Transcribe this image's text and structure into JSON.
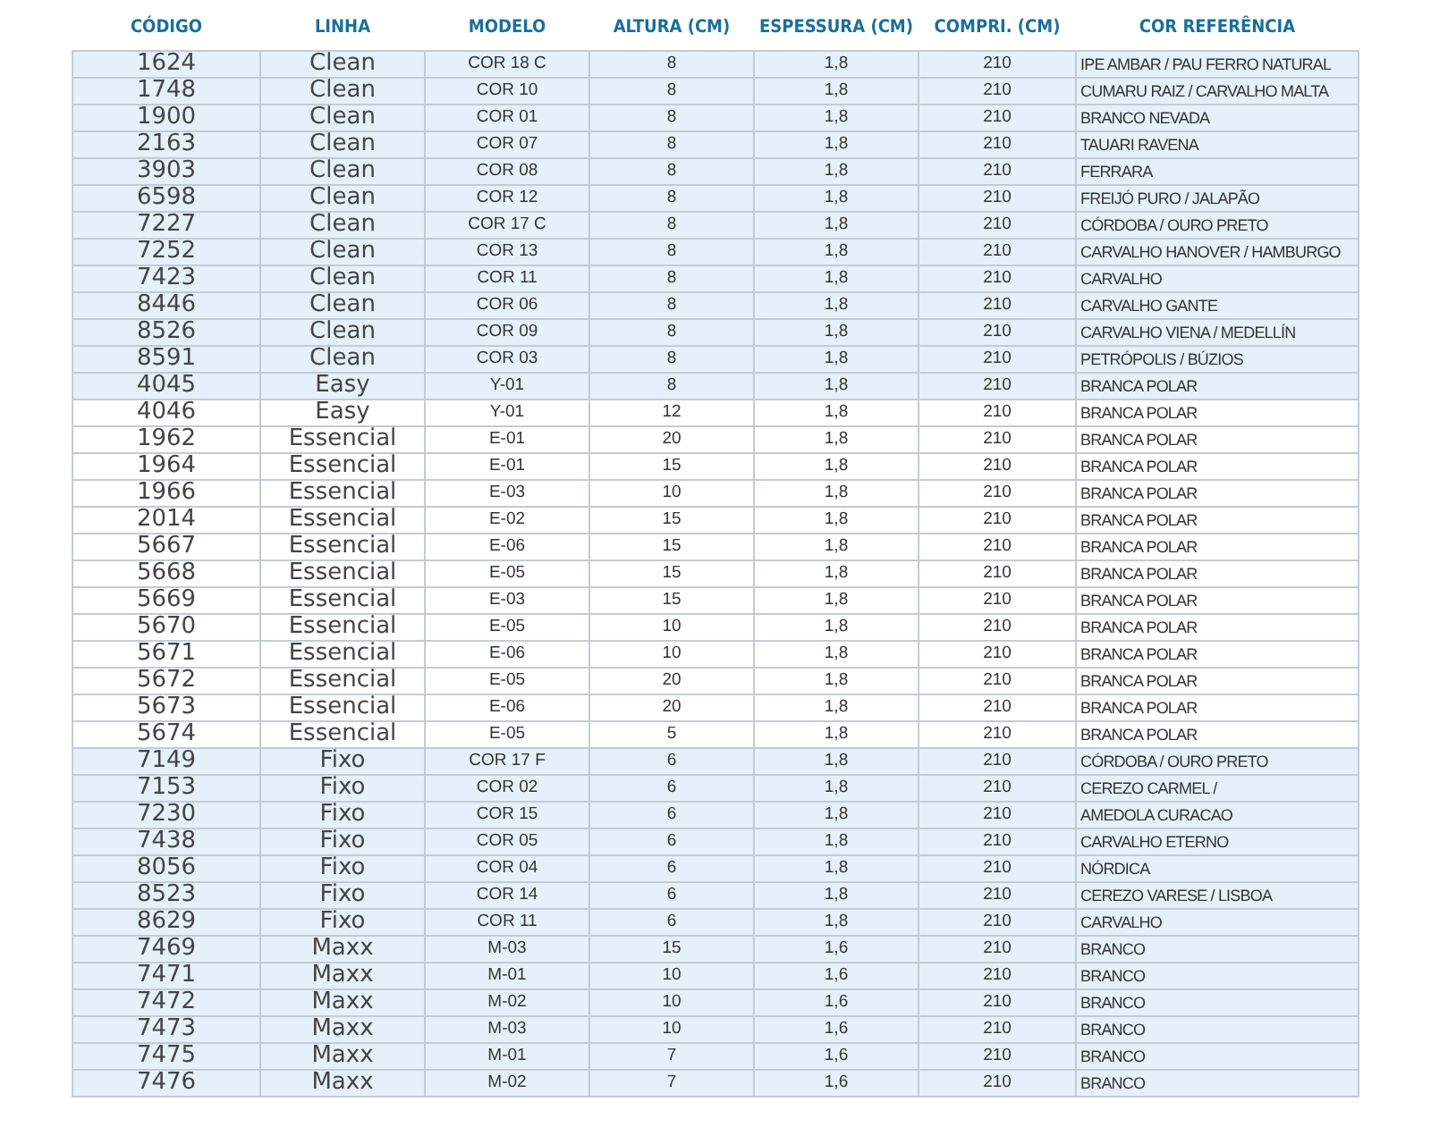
{
  "columns": [
    "CÓDIGO",
    "LINHA",
    "MODELO",
    "ALTURA (CM)",
    "ESPESSURA (CM)",
    "COMPRI. (CM)",
    "COR REFERÊNCIA"
  ],
  "rows": [
    {
      "cells": [
        "1624",
        "Clean",
        "COR 18 C",
        "8",
        "1,8",
        "210",
        "IPE AMBAR / PAU FERRO NATURAL"
      ],
      "highlighted": true
    },
    {
      "cells": [
        "1748",
        "Clean",
        "COR 10",
        "8",
        "1,8",
        "210",
        "CUMARU RAIZ / CARVALHO MALTA"
      ],
      "highlighted": true
    },
    {
      "cells": [
        "1900",
        "Clean",
        "COR 01",
        "8",
        "1,8",
        "210",
        "BRANCO NEVADA"
      ],
      "highlighted": true
    },
    {
      "cells": [
        "2163",
        "Clean",
        "COR 07",
        "8",
        "1,8",
        "210",
        "TAUARI RAVENA"
      ],
      "highlighted": true
    },
    {
      "cells": [
        "3903",
        "Clean",
        "COR 08",
        "8",
        "1,8",
        "210",
        "FERRARA"
      ],
      "highlighted": true
    },
    {
      "cells": [
        "6598",
        "Clean",
        "COR 12",
        "8",
        "1,8",
        "210",
        "FREIJÓ PURO / JALAPÃO"
      ],
      "highlighted": true
    },
    {
      "cells": [
        "7227",
        "Clean",
        "COR 17 C",
        "8",
        "1,8",
        "210",
        "CÓRDOBA / OURO PRETO"
      ],
      "highlighted": true
    },
    {
      "cells": [
        "7252",
        "Clean",
        "COR 13",
        "8",
        "1,8",
        "210",
        "CARVALHO HANOVER / HAMBURGO"
      ],
      "highlighted": true
    },
    {
      "cells": [
        "7423",
        "Clean",
        "COR 11",
        "8",
        "1,8",
        "210",
        "CARVALHO"
      ],
      "highlighted": true
    },
    {
      "cells": [
        "8446",
        "Clean",
        "COR 06",
        "8",
        "1,8",
        "210",
        "CARVALHO GANTE"
      ],
      "highlighted": true
    },
    {
      "cells": [
        "8526",
        "Clean",
        "COR 09",
        "8",
        "1,8",
        "210",
        "CARVALHO VIENA / MEDELLÍN"
      ],
      "highlighted": true
    },
    {
      "cells": [
        "8591",
        "Clean",
        "COR 03",
        "8",
        "1,8",
        "210",
        "PETRÓPOLIS / BÚZIOS"
      ],
      "highlighted": true
    },
    {
      "cells": [
        "4045",
        "Easy",
        "Y-01",
        "8",
        "1,8",
        "210",
        "BRANCA POLAR"
      ],
      "highlighted": true
    },
    {
      "cells": [
        "4046",
        "Easy",
        "Y-01",
        "12",
        "1,8",
        "210",
        "BRANCA POLAR"
      ],
      "highlighted": false
    },
    {
      "cells": [
        "1962",
        "Essencial",
        "E-01",
        "20",
        "1,8",
        "210",
        "BRANCA POLAR"
      ],
      "highlighted": false
    },
    {
      "cells": [
        "1964",
        "Essencial",
        "E-01",
        "15",
        "1,8",
        "210",
        "BRANCA POLAR"
      ],
      "highlighted": false
    },
    {
      "cells": [
        "1966",
        "Essencial",
        "E-03",
        "10",
        "1,8",
        "210",
        "BRANCA POLAR"
      ],
      "highlighted": false
    },
    {
      "cells": [
        "2014",
        "Essencial",
        "E-02",
        "15",
        "1,8",
        "210",
        "BRANCA POLAR"
      ],
      "highlighted": false
    },
    {
      "cells": [
        "5667",
        "Essencial",
        "E-06",
        "15",
        "1,8",
        "210",
        "BRANCA POLAR"
      ],
      "highlighted": false
    },
    {
      "cells": [
        "5668",
        "Essencial",
        "E-05",
        "15",
        "1,8",
        "210",
        "BRANCA POLAR"
      ],
      "highlighted": false
    },
    {
      "cells": [
        "5669",
        "Essencial",
        "E-03",
        "15",
        "1,8",
        "210",
        "BRANCA POLAR"
      ],
      "highlighted": false
    },
    {
      "cells": [
        "5670",
        "Essencial",
        "E-05",
        "10",
        "1,8",
        "210",
        "BRANCA POLAR"
      ],
      "highlighted": false
    },
    {
      "cells": [
        "5671",
        "Essencial",
        "E-06",
        "10",
        "1,8",
        "210",
        "BRANCA POLAR"
      ],
      "highlighted": false
    },
    {
      "cells": [
        "5672",
        "Essencial",
        "E-05",
        "20",
        "1,8",
        "210",
        "BRANCA POLAR"
      ],
      "highlighted": false
    },
    {
      "cells": [
        "5673",
        "Essencial",
        "E-06",
        "20",
        "1,8",
        "210",
        "BRANCA POLAR"
      ],
      "highlighted": false
    },
    {
      "cells": [
        "5674",
        "Essencial",
        "E-05",
        "5",
        "1,8",
        "210",
        "BRANCA POLAR"
      ],
      "highlighted": false
    },
    {
      "cells": [
        "7149",
        "Fixo",
        "COR 17 F",
        "6",
        "1,8",
        "210",
        "CÓRDOBA / OURO PRETO"
      ],
      "highlighted": true
    },
    {
      "cells": [
        "7153",
        "Fixo",
        "COR 02",
        "6",
        "1,8",
        "210",
        "CEREZO CARMEL /"
      ],
      "highlighted": true
    },
    {
      "cells": [
        "7230",
        "Fixo",
        "COR 15",
        "6",
        "1,8",
        "210",
        "AMEDOLA CURACAO"
      ],
      "highlighted": true
    },
    {
      "cells": [
        "7438",
        "Fixo",
        "COR 05",
        "6",
        "1,8",
        "210",
        "CARVALHO ETERNO"
      ],
      "highlighted": true
    },
    {
      "cells": [
        "8056",
        "Fixo",
        "COR 04",
        "6",
        "1,8",
        "210",
        "NÓRDICA"
      ],
      "highlighted": true
    },
    {
      "cells": [
        "8523",
        "Fixo",
        "COR 14",
        "6",
        "1,8",
        "210",
        "CEREZO VARESE / LISBOA"
      ],
      "highlighted": true
    },
    {
      "cells": [
        "8629",
        "Fixo",
        "COR 11",
        "6",
        "1,8",
        "210",
        "CARVALHO"
      ],
      "highlighted": true
    },
    {
      "cells": [
        "7469",
        "Maxx",
        "M-03",
        "15",
        "1,6",
        "210",
        "BRANCO"
      ],
      "highlighted": true
    },
    {
      "cells": [
        "7471",
        "Maxx",
        "M-01",
        "10",
        "1,6",
        "210",
        "BRANCO"
      ],
      "highlighted": true
    },
    {
      "cells": [
        "7472",
        "Maxx",
        "M-02",
        "10",
        "1,6",
        "210",
        "BRANCO"
      ],
      "highlighted": true
    },
    {
      "cells": [
        "7473",
        "Maxx",
        "M-03",
        "10",
        "1,6",
        "210",
        "BRANCO"
      ],
      "highlighted": true
    },
    {
      "cells": [
        "7475",
        "Maxx",
        "M-01",
        "7",
        "1,6",
        "210",
        "BRANCO"
      ],
      "highlighted": true
    },
    {
      "cells": [
        "7476",
        "Maxx",
        "M-02",
        "7",
        "1,6",
        "210",
        "BRANCO"
      ],
      "highlighted": true
    }
  ]
}
